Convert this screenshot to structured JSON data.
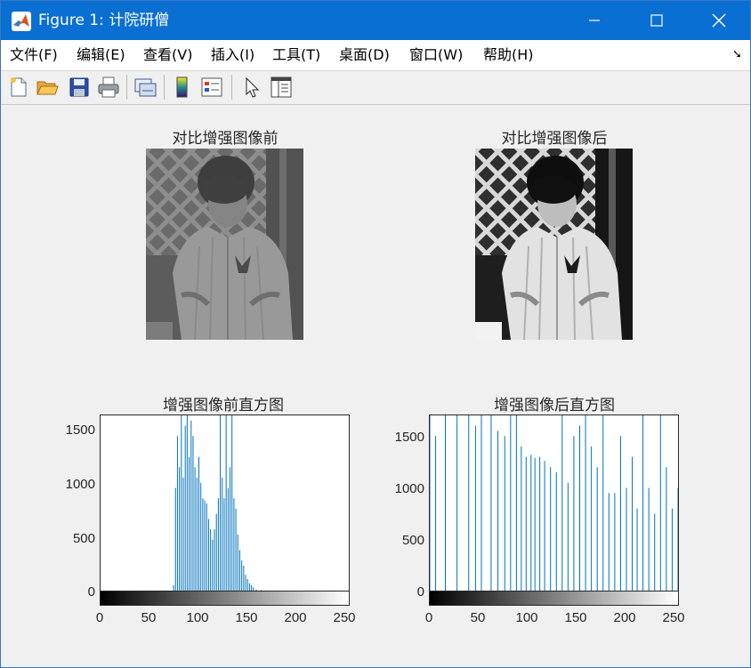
{
  "window": {
    "title": "Figure 1: 计院研僧",
    "brand_color": "#0a6fd2"
  },
  "menu": [
    {
      "label": "文件(F)"
    },
    {
      "label": "编辑(E)"
    },
    {
      "label": "查看(V)"
    },
    {
      "label": "插入(I)"
    },
    {
      "label": "工具(T)"
    },
    {
      "label": "桌面(D)"
    },
    {
      "label": "窗口(W)"
    },
    {
      "label": "帮助(H)"
    }
  ],
  "toolbar": {
    "icons": [
      "new-figure-icon",
      "open-file-icon",
      "save-icon",
      "print-icon",
      "link-plot-icon",
      "colorbar-icon",
      "legend-icon",
      "pointer-icon",
      "property-inspector-icon"
    ]
  },
  "images": [
    {
      "title": "对比增强图像前"
    },
    {
      "title": "对比增强图像后"
    }
  ],
  "histograms": [
    {
      "title": "增强图像前直方图",
      "yticks": [
        "1500",
        "1000",
        "500",
        "0"
      ],
      "xticks": [
        "0",
        "50",
        "100",
        "150",
        "200",
        "250"
      ]
    },
    {
      "title": "增强图像后直方图",
      "yticks": [
        "1500",
        "1000",
        "500",
        "0"
      ],
      "xticks": [
        "0",
        "50",
        "100",
        "150",
        "200",
        "250"
      ]
    }
  ],
  "chart_data": [
    {
      "type": "bar",
      "title": "增强图像前直方图",
      "xlim": [
        0,
        255
      ],
      "ylim": [
        0,
        1700
      ],
      "x_bins": [
        75,
        77,
        79,
        81,
        83,
        85,
        87,
        89,
        91,
        93,
        95,
        97,
        99,
        101,
        103,
        105,
        107,
        109,
        111,
        113,
        115,
        117,
        119,
        121,
        123,
        125,
        127,
        129,
        131,
        133,
        135,
        137,
        139,
        141,
        143,
        145,
        147,
        149,
        151,
        153,
        155,
        157,
        160,
        165,
        170,
        180,
        190,
        200
      ],
      "values": [
        60,
        1000,
        1500,
        1200,
        1700,
        1100,
        1600,
        1700,
        1300,
        1650,
        1500,
        1200,
        1100,
        1300,
        1050,
        900,
        880,
        850,
        700,
        600,
        500,
        600,
        750,
        900,
        1700,
        1100,
        900,
        1700,
        1000,
        1200,
        1700,
        900,
        800,
        550,
        400,
        300,
        250,
        160,
        120,
        80,
        60,
        40,
        20,
        15,
        10,
        8,
        5,
        3
      ],
      "color": "#0072bd",
      "colorbar": "gray"
    },
    {
      "type": "bar",
      "title": "增强图像后直方图",
      "xlim": [
        0,
        255
      ],
      "ylim": [
        0,
        1700
      ],
      "x_bins": [
        0,
        6,
        16,
        28,
        40,
        47,
        53,
        63,
        70,
        77,
        83,
        89,
        94,
        99,
        104,
        108,
        113,
        118,
        124,
        130,
        136,
        142,
        148,
        154,
        160,
        166,
        172,
        178,
        184,
        190,
        196,
        202,
        208,
        213,
        219,
        225,
        231,
        237,
        243,
        249,
        255
      ],
      "values": [
        1700,
        1500,
        1700,
        1700,
        1700,
        1600,
        1700,
        1700,
        1550,
        1500,
        1700,
        1700,
        1400,
        1300,
        1320,
        1290,
        1300,
        1260,
        1200,
        1150,
        1700,
        1050,
        1500,
        1600,
        1700,
        1400,
        1200,
        1700,
        950,
        950,
        1500,
        1000,
        1300,
        800,
        1700,
        1000,
        750,
        1700,
        1200,
        800,
        1000
      ],
      "color": "#0072bd",
      "colorbar": "gray"
    }
  ]
}
